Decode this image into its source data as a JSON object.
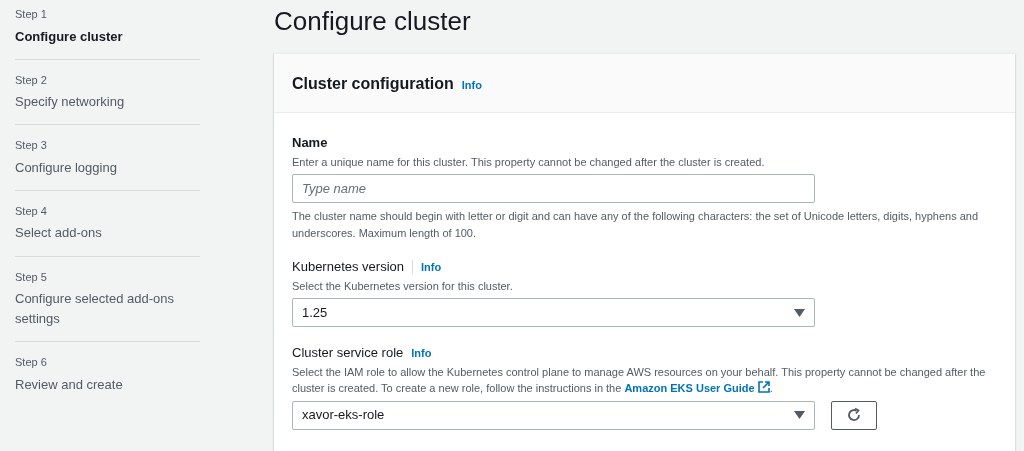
{
  "steps": [
    {
      "step": "Step 1",
      "label": "Configure cluster",
      "selected": true
    },
    {
      "step": "Step 2",
      "label": "Specify networking",
      "selected": false
    },
    {
      "step": "Step 3",
      "label": "Configure logging",
      "selected": false
    },
    {
      "step": "Step 4",
      "label": "Select add-ons",
      "selected": false
    },
    {
      "step": "Step 5",
      "label": "Configure selected add-ons settings",
      "selected": false
    },
    {
      "step": "Step 6",
      "label": "Review and create",
      "selected": false
    }
  ],
  "page_title": "Configure cluster",
  "panel": {
    "title": "Cluster configuration",
    "info": "Info",
    "fields": [
      {
        "kind": "text",
        "label": "Name",
        "description": "Enter a unique name for this cluster. This property cannot be changed after the cluster is created.",
        "placeholder": "Type name",
        "constraint": "The cluster name should begin with letter or digit and can have any of the following characters: the set of Unicode letters, digits, hyphens and underscores. Maximum length of 100."
      },
      {
        "kind": "select",
        "label": "Kubernetes version",
        "info": "Info",
        "info_divider": true,
        "description": "Select the Kubernetes version for this cluster.",
        "value": "1.25"
      },
      {
        "kind": "select",
        "label": "Cluster service role",
        "info": "Info",
        "description": "Select the IAM role to allow the Kubernetes control plane to manage AWS resources on your behalf. This property cannot be changed after the cluster is created. To create a new role, follow the instructions in the",
        "link": "Amazon EKS User Guide",
        "description_end": ".",
        "value": "xavor-eks-role",
        "refresh": true
      }
    ]
  }
}
